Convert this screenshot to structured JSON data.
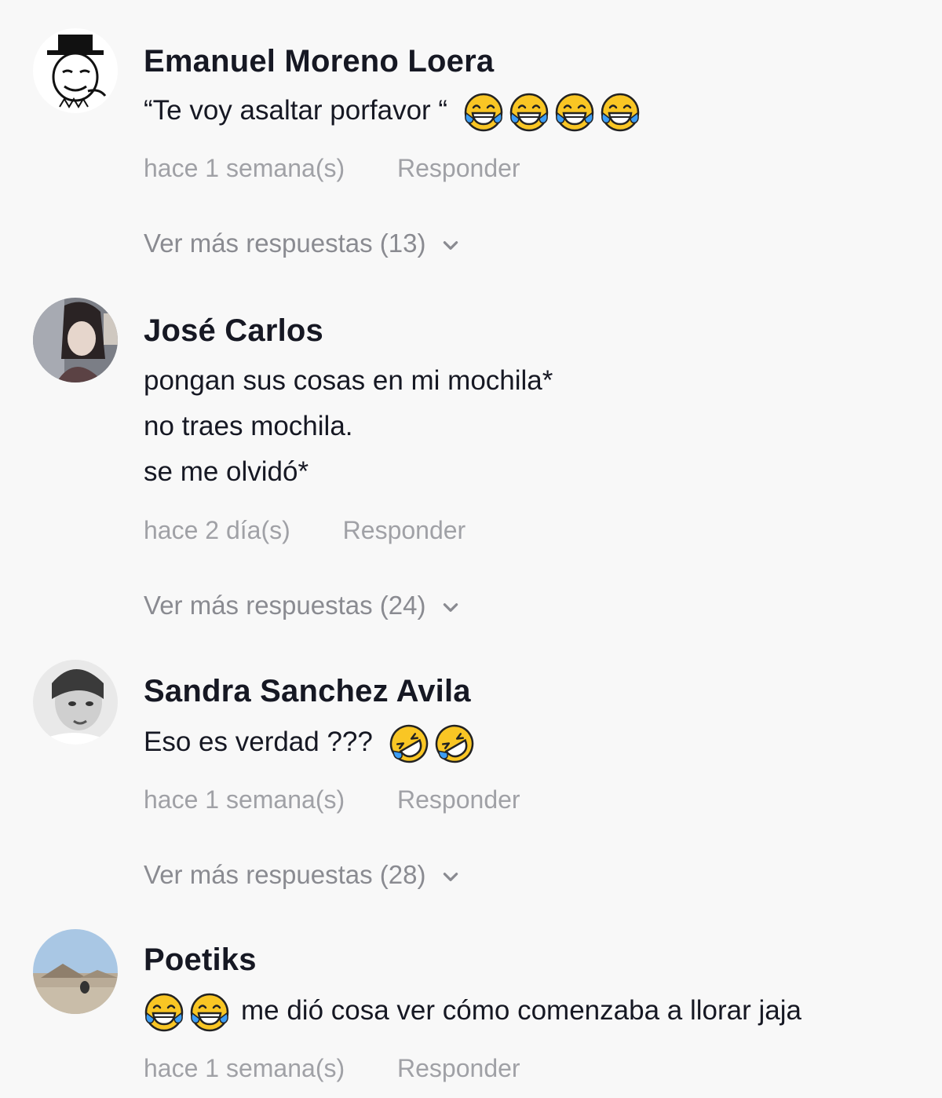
{
  "comments": [
    {
      "username": "Emanuel Moreno Loera",
      "text_lines": [
        "“Te voy asaltar porfavor “"
      ],
      "emoji_after": [
        "face-with-tears-of-joy",
        "face-with-tears-of-joy",
        "face-with-tears-of-joy",
        "face-with-tears-of-joy"
      ],
      "time": "hace 1 semana(s)",
      "reply_label": "Responder",
      "more_replies": "Ver más respuestas (13)"
    },
    {
      "username": "José Carlos",
      "text_lines": [
        "pongan sus cosas en mi mochila*",
        "no traes mochila.",
        "se me olvidó*"
      ],
      "time": "hace 2 día(s)",
      "reply_label": "Responder",
      "more_replies": "Ver más respuestas (24)"
    },
    {
      "username": "Sandra Sanchez Avila",
      "text_lines": [
        "Eso es verdad ???"
      ],
      "emoji_after": [
        "rolling-on-floor-laughing",
        "rolling-on-floor-laughing"
      ],
      "time": "hace 1 semana(s)",
      "reply_label": "Responder",
      "more_replies": "Ver más respuestas (28)"
    },
    {
      "username": "Poetiks",
      "emoji_before": [
        "face-with-tears-of-joy",
        "face-with-tears-of-joy"
      ],
      "text_lines": [
        "me dió cosa ver cómo comenzaba a llorar jaja"
      ],
      "time": "hace 1 semana(s)",
      "reply_label": "Responder"
    }
  ],
  "colors": {
    "background": "#f8f8f8",
    "username": "#161823",
    "meta": "#a0a1a6",
    "more": "#8a8b91",
    "emoji_face": "#f9c624",
    "emoji_tears": "#3d9ef5"
  },
  "icons": {
    "chevron": "chevron-down-icon",
    "emoji_joy": "face-with-tears-of-joy",
    "emoji_rofl": "rolling-on-floor-laughing"
  }
}
